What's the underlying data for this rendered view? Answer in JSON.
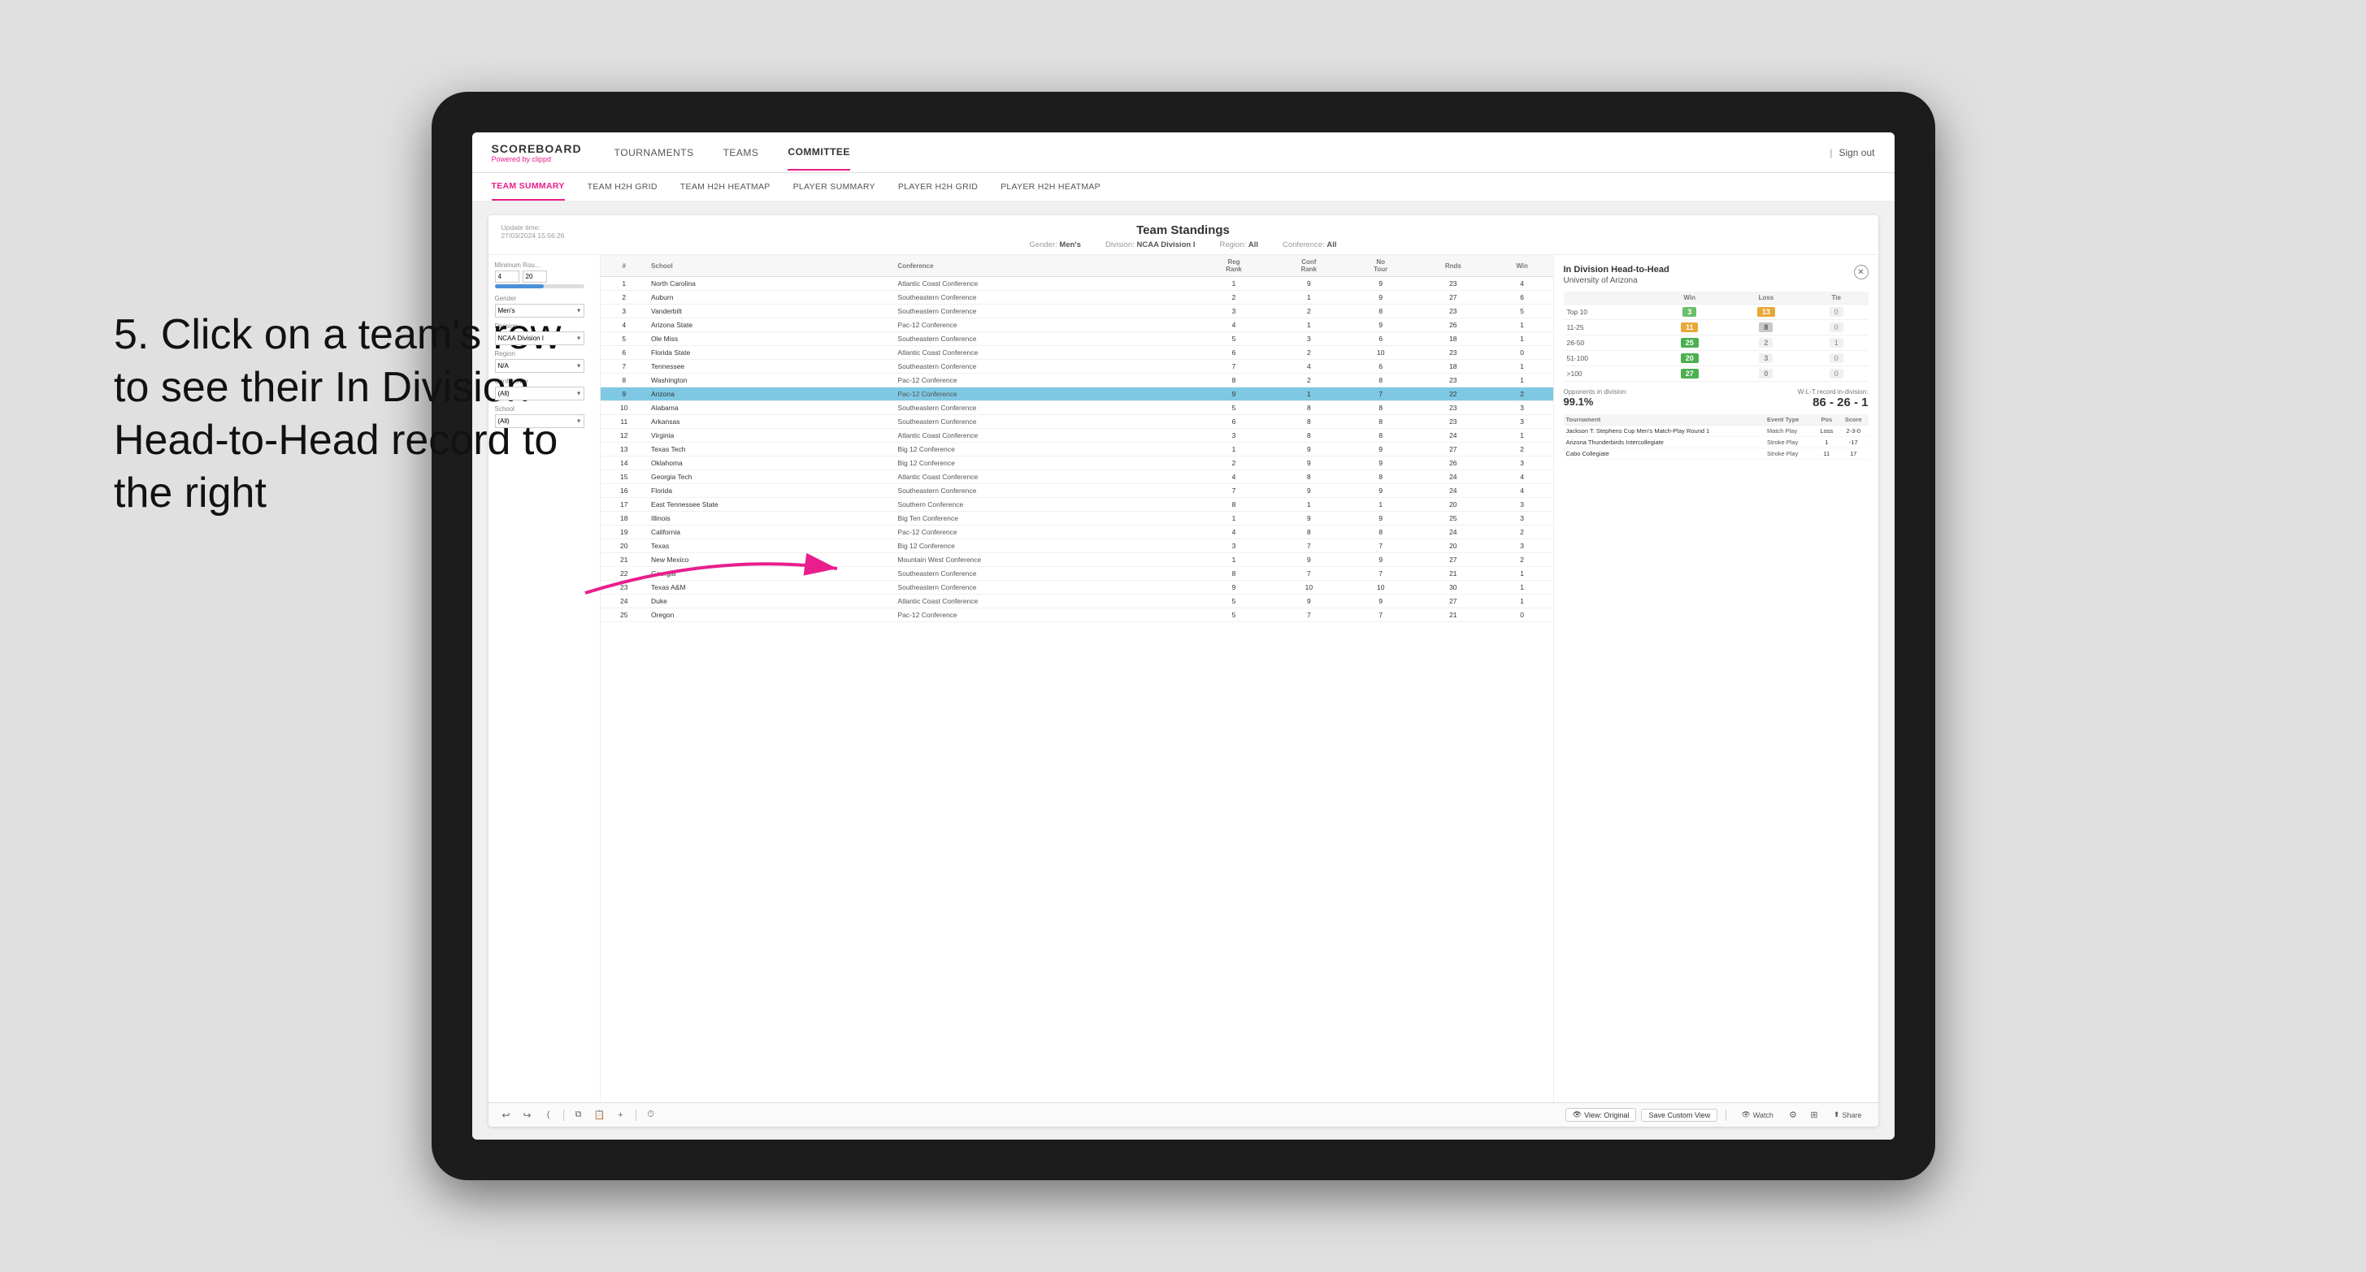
{
  "app": {
    "logo_line1": "SCOREBOARD",
    "logo_line2": "Powered by clippd",
    "sign_out": "Sign out"
  },
  "main_nav": {
    "items": [
      {
        "label": "TOURNAMENTS",
        "active": false
      },
      {
        "label": "TEAMS",
        "active": false
      },
      {
        "label": "COMMITTEE",
        "active": true
      }
    ]
  },
  "sub_nav": {
    "items": [
      {
        "label": "TEAM SUMMARY",
        "active": true
      },
      {
        "label": "TEAM H2H GRID",
        "active": false
      },
      {
        "label": "TEAM H2H HEATMAP",
        "active": false
      },
      {
        "label": "PLAYER SUMMARY",
        "active": false
      },
      {
        "label": "PLAYER H2H GRID",
        "active": false
      },
      {
        "label": "PLAYER H2H HEATMAP",
        "active": false
      }
    ]
  },
  "panel": {
    "update_time": "Update time:",
    "update_date": "27/03/2024 15:56:26",
    "title": "Team Standings",
    "gender_label": "Gender:",
    "gender_value": "Men's",
    "division_label": "Division:",
    "division_value": "NCAA Division I",
    "region_label": "Region:",
    "region_value": "All",
    "conference_label": "Conference:",
    "conference_value": "All"
  },
  "controls": {
    "min_rounds_label": "Minimum Rou...",
    "min_rounds_min": "4",
    "min_rounds_max": "20",
    "gender_label": "Gender",
    "gender_value": "Men's",
    "division_label": "Division",
    "division_value": "NCAA Division I",
    "region_label": "Region",
    "region_value": "N/A",
    "conference_label": "Conference",
    "conference_value": "(All)",
    "school_label": "School",
    "school_value": "(All)"
  },
  "table": {
    "headers": [
      "#",
      "School",
      "Conference",
      "Reg Rank",
      "Conf Rank",
      "No Tour",
      "Rnds",
      "Win"
    ],
    "rows": [
      {
        "rank": 1,
        "school": "North Carolina",
        "conference": "Atlantic Coast Conference",
        "reg_rank": 1,
        "conf_rank": 9,
        "no_tour": 9,
        "rnds": 23,
        "win": 4
      },
      {
        "rank": 2,
        "school": "Auburn",
        "conference": "Southeastern Conference",
        "reg_rank": 2,
        "conf_rank": 1,
        "no_tour": 9,
        "rnds": 27,
        "win": 6
      },
      {
        "rank": 3,
        "school": "Vanderbilt",
        "conference": "Southeastern Conference",
        "reg_rank": 3,
        "conf_rank": 2,
        "no_tour": 8,
        "rnds": 23,
        "win": 5
      },
      {
        "rank": 4,
        "school": "Arizona State",
        "conference": "Pac-12 Conference",
        "reg_rank": 4,
        "conf_rank": 1,
        "no_tour": 9,
        "rnds": 26,
        "win": 1
      },
      {
        "rank": 5,
        "school": "Ole Miss",
        "conference": "Southeastern Conference",
        "reg_rank": 5,
        "conf_rank": 3,
        "no_tour": 6,
        "rnds": 18,
        "win": 1
      },
      {
        "rank": 6,
        "school": "Florida State",
        "conference": "Atlantic Coast Conference",
        "reg_rank": 6,
        "conf_rank": 2,
        "no_tour": 10,
        "rnds": 23,
        "win": 0
      },
      {
        "rank": 7,
        "school": "Tennessee",
        "conference": "Southeastern Conference",
        "reg_rank": 7,
        "conf_rank": 4,
        "no_tour": 6,
        "rnds": 18,
        "win": 1
      },
      {
        "rank": 8,
        "school": "Washington",
        "conference": "Pac-12 Conference",
        "reg_rank": 8,
        "conf_rank": 2,
        "no_tour": 8,
        "rnds": 23,
        "win": 1
      },
      {
        "rank": 9,
        "school": "Arizona",
        "conference": "Pac-12 Conference",
        "reg_rank": 9,
        "conf_rank": 1,
        "no_tour": 7,
        "rnds": 22,
        "win": 2,
        "highlighted": true
      },
      {
        "rank": 10,
        "school": "Alabama",
        "conference": "Southeastern Conference",
        "reg_rank": 5,
        "conf_rank": 8,
        "no_tour": 8,
        "rnds": 23,
        "win": 3
      },
      {
        "rank": 11,
        "school": "Arkansas",
        "conference": "Southeastern Conference",
        "reg_rank": 6,
        "conf_rank": 8,
        "no_tour": 8,
        "rnds": 23,
        "win": 3
      },
      {
        "rank": 12,
        "school": "Virginia",
        "conference": "Atlantic Coast Conference",
        "reg_rank": 3,
        "conf_rank": 8,
        "no_tour": 8,
        "rnds": 24,
        "win": 1
      },
      {
        "rank": 13,
        "school": "Texas Tech",
        "conference": "Big 12 Conference",
        "reg_rank": 1,
        "conf_rank": 9,
        "no_tour": 9,
        "rnds": 27,
        "win": 2
      },
      {
        "rank": 14,
        "school": "Oklahoma",
        "conference": "Big 12 Conference",
        "reg_rank": 2,
        "conf_rank": 9,
        "no_tour": 9,
        "rnds": 26,
        "win": 3
      },
      {
        "rank": 15,
        "school": "Georgia Tech",
        "conference": "Atlantic Coast Conference",
        "reg_rank": 4,
        "conf_rank": 8,
        "no_tour": 8,
        "rnds": 24,
        "win": 4
      },
      {
        "rank": 16,
        "school": "Florida",
        "conference": "Southeastern Conference",
        "reg_rank": 7,
        "conf_rank": 9,
        "no_tour": 9,
        "rnds": 24,
        "win": 4
      },
      {
        "rank": 17,
        "school": "East Tennessee State",
        "conference": "Southern Conference",
        "reg_rank": 8,
        "conf_rank": 1,
        "no_tour": 1,
        "rnds": 20,
        "win": 3
      },
      {
        "rank": 18,
        "school": "Illinois",
        "conference": "Big Ten Conference",
        "reg_rank": 1,
        "conf_rank": 9,
        "no_tour": 9,
        "rnds": 25,
        "win": 3
      },
      {
        "rank": 19,
        "school": "California",
        "conference": "Pac-12 Conference",
        "reg_rank": 4,
        "conf_rank": 8,
        "no_tour": 8,
        "rnds": 24,
        "win": 2
      },
      {
        "rank": 20,
        "school": "Texas",
        "conference": "Big 12 Conference",
        "reg_rank": 3,
        "conf_rank": 7,
        "no_tour": 7,
        "rnds": 20,
        "win": 3
      },
      {
        "rank": 21,
        "school": "New Mexico",
        "conference": "Mountain West Conference",
        "reg_rank": 1,
        "conf_rank": 9,
        "no_tour": 9,
        "rnds": 27,
        "win": 2
      },
      {
        "rank": 22,
        "school": "Georgia",
        "conference": "Southeastern Conference",
        "reg_rank": 8,
        "conf_rank": 7,
        "no_tour": 7,
        "rnds": 21,
        "win": 1
      },
      {
        "rank": 23,
        "school": "Texas A&M",
        "conference": "Southeastern Conference",
        "reg_rank": 9,
        "conf_rank": 10,
        "no_tour": 10,
        "rnds": 30,
        "win": 1
      },
      {
        "rank": 24,
        "school": "Duke",
        "conference": "Atlantic Coast Conference",
        "reg_rank": 5,
        "conf_rank": 9,
        "no_tour": 9,
        "rnds": 27,
        "win": 1
      },
      {
        "rank": 25,
        "school": "Oregon",
        "conference": "Pac-12 Conference",
        "reg_rank": 5,
        "conf_rank": 7,
        "no_tour": 7,
        "rnds": 21,
        "win": 0
      }
    ]
  },
  "h2h": {
    "title": "In Division Head-to-Head",
    "school": "University of Arizona",
    "win_label": "Win",
    "loss_label": "Loss",
    "tie_label": "Tie",
    "rows": [
      {
        "range": "Top 10",
        "win": 3,
        "loss": 13,
        "tie": 0,
        "win_class": "cell-green",
        "loss_class": "cell-orange",
        "tie_class": "cell-gray"
      },
      {
        "range": "11-25",
        "win": 11,
        "loss": 8,
        "tie": 0,
        "win_class": "cell-orange",
        "loss_class": "cell-light",
        "tie_class": "cell-gray"
      },
      {
        "range": "26-50",
        "win": 25,
        "loss": 2,
        "tie": 1,
        "win_class": "cell-darkgreen",
        "loss_class": "cell-gray",
        "tie_class": "cell-gray"
      },
      {
        "range": "51-100",
        "win": 20,
        "loss": 3,
        "tie": 0,
        "win_class": "cell-darkgreen",
        "loss_class": "cell-gray",
        "tie_class": "cell-gray"
      },
      {
        "range": ">100",
        "win": 27,
        "loss": 0,
        "tie": 0,
        "win_class": "cell-darkgreen",
        "loss_class": "cell-gray",
        "tie_class": "cell-gray"
      }
    ],
    "opponents_label": "Opponents in division:",
    "opponents_value": "99.1%",
    "record_label": "W-L-T record in-division:",
    "record_value": "86 - 26 - 1",
    "tournaments": [
      {
        "name": "Jackson T. Stephens Cup Men's Match-Play Round 1",
        "event_type": "Match Play",
        "pos": "Loss",
        "score": "2-3-0"
      },
      {
        "name": "Arizona Thunderbirds Intercollegiate",
        "event_type": "Stroke Play",
        "pos": "1",
        "score": "-17"
      },
      {
        "name": "Cabo Collegiate",
        "event_type": "Stroke Play",
        "pos": "11",
        "score": "17"
      }
    ]
  },
  "toolbar": {
    "view_original": "View: Original",
    "save_custom": "Save Custom View",
    "watch": "Watch",
    "share": "Share"
  },
  "instruction": {
    "text": "5. Click on a team's row to see their In Division Head-to-Head record to the right"
  }
}
